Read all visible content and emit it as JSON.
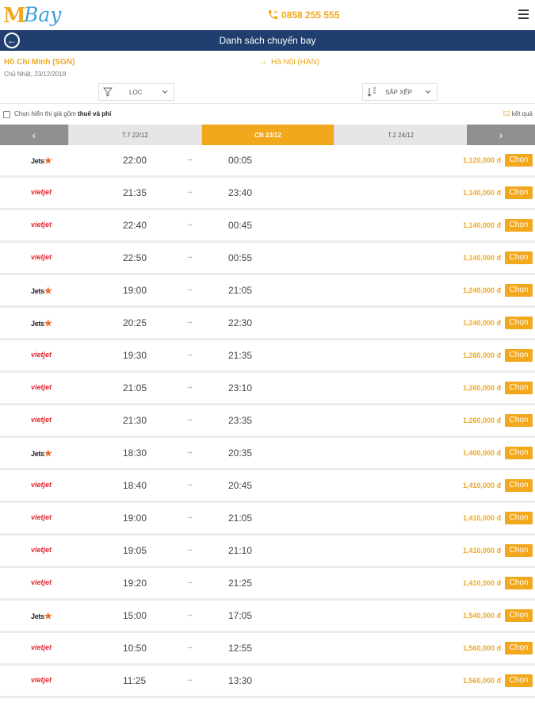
{
  "brand": {
    "logo_m": "M",
    "logo_bay": "Bay",
    "phone": "0858 255 555"
  },
  "nav": {
    "title": "Danh sách chuyến bay"
  },
  "route": {
    "from": "Hồ Chí Minh (SGN)",
    "date": "Chủ Nhật, 23/12/2018",
    "to": "Hà Nội (HAN)"
  },
  "controls": {
    "filter_label": "LỌC",
    "sort_label": "SẮP XẾP"
  },
  "options": {
    "include_fees_prefix": "Chọn hiển thị giá gồm",
    "include_fees_bold": "thuế và phí",
    "result_count": "52",
    "result_suffix": " kết quả"
  },
  "dates": {
    "prev": "‹",
    "next": "›",
    "days": [
      "T.7 22/12",
      "CN 23/12",
      "T.2 24/12"
    ],
    "active_index": 1
  },
  "colors": {
    "accent": "#f2a81d",
    "navbar": "#213f6e",
    "vietjet": "#e3262f",
    "jetstar": "#f26522"
  },
  "choose_label": "Chọn",
  "flights": [
    {
      "airline": "Jetstar",
      "dep": "22:00",
      "arr": "00:05",
      "price": "1,120,000 đ"
    },
    {
      "airline": "VietJet",
      "dep": "21:35",
      "arr": "23:40",
      "price": "1,140,000 đ"
    },
    {
      "airline": "VietJet",
      "dep": "22:40",
      "arr": "00:45",
      "price": "1,140,000 đ"
    },
    {
      "airline": "VietJet",
      "dep": "22:50",
      "arr": "00:55",
      "price": "1,140,000 đ"
    },
    {
      "airline": "Jetstar",
      "dep": "19:00",
      "arr": "21:05",
      "price": "1,240,000 đ"
    },
    {
      "airline": "Jetstar",
      "dep": "20:25",
      "arr": "22:30",
      "price": "1,240,000 đ"
    },
    {
      "airline": "VietJet",
      "dep": "19:30",
      "arr": "21:35",
      "price": "1,260,000 đ"
    },
    {
      "airline": "VietJet",
      "dep": "21:05",
      "arr": "23:10",
      "price": "1,260,000 đ"
    },
    {
      "airline": "VietJet",
      "dep": "21:30",
      "arr": "23:35",
      "price": "1,260,000 đ"
    },
    {
      "airline": "Jetstar",
      "dep": "18:30",
      "arr": "20:35",
      "price": "1,400,000 đ"
    },
    {
      "airline": "VietJet",
      "dep": "18:40",
      "arr": "20:45",
      "price": "1,410,000 đ"
    },
    {
      "airline": "VietJet",
      "dep": "19:00",
      "arr": "21:05",
      "price": "1,410,000 đ"
    },
    {
      "airline": "VietJet",
      "dep": "19:05",
      "arr": "21:10",
      "price": "1,410,000 đ"
    },
    {
      "airline": "VietJet",
      "dep": "19:20",
      "arr": "21:25",
      "price": "1,410,000 đ"
    },
    {
      "airline": "Jetstar",
      "dep": "15:00",
      "arr": "17:05",
      "price": "1,540,000 đ"
    },
    {
      "airline": "VietJet",
      "dep": "10:50",
      "arr": "12:55",
      "price": "1,560,000 đ"
    },
    {
      "airline": "VietJet",
      "dep": "11:25",
      "arr": "13:30",
      "price": "1,560,000 đ"
    }
  ]
}
